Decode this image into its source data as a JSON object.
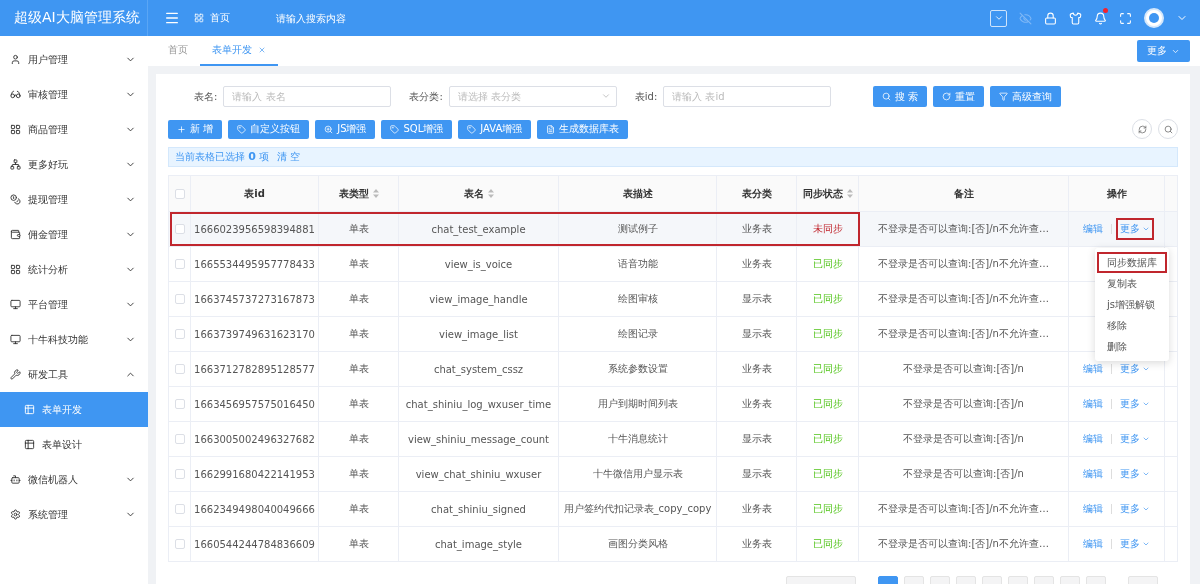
{
  "app": {
    "title": "超级AI大脑管理系统"
  },
  "topbar": {
    "home": "首页",
    "search": {
      "placeholder": "请输入搜索内容"
    },
    "notification_dot": true
  },
  "sidebar": {
    "items": [
      {
        "label": "用户管理",
        "expanded": false
      },
      {
        "label": "审核管理",
        "expanded": false
      },
      {
        "label": "商品管理",
        "expanded": false
      },
      {
        "label": "更多好玩",
        "expanded": false
      },
      {
        "label": "提现管理",
        "expanded": false
      },
      {
        "label": "佣金管理",
        "expanded": false
      },
      {
        "label": "统计分析",
        "expanded": false
      },
      {
        "label": "平台管理",
        "expanded": false
      },
      {
        "label": "十牛科技功能",
        "expanded": false
      },
      {
        "label": "研发工具",
        "expanded": true,
        "children": [
          {
            "label": "表单开发",
            "selected": true
          },
          {
            "label": "表单设计",
            "selected": false
          }
        ]
      },
      {
        "label": "微信机器人",
        "expanded": false
      },
      {
        "label": "系统管理",
        "expanded": false
      }
    ]
  },
  "tabs": [
    {
      "label": "首页",
      "selected": false,
      "closable": false
    },
    {
      "label": "表单开发",
      "selected": true,
      "closable": true
    }
  ],
  "tabs_more": "更多",
  "filters": [
    {
      "label": "表名:",
      "kind": "input",
      "placeholder": "请输入 表名"
    },
    {
      "label": "表分类:",
      "kind": "select",
      "placeholder": "请选择 表分类"
    },
    {
      "label": "表id:",
      "kind": "input",
      "placeholder": "请输入 表id"
    }
  ],
  "filter_buttons": [
    "搜 索",
    "重置",
    "高级查询"
  ],
  "toolbar": [
    "新 增",
    "自定义按钮",
    "JS增强",
    "SQL增强",
    "JAVA增强",
    "生成数据库表"
  ],
  "selection": {
    "text": "当前表格已选择 **0** 项",
    "clear": "清 空"
  },
  "table": {
    "all_checked": false,
    "columns": [
      {
        "label": "表id",
        "sortable": false
      },
      {
        "label": "表类型",
        "sortable": true
      },
      {
        "label": "表名",
        "sortable": true
      },
      {
        "label": "表描述",
        "sortable": false
      },
      {
        "label": "表分类",
        "sortable": false
      },
      {
        "label": "同步状态",
        "sortable": true
      },
      {
        "label": "备注",
        "sortable": false
      },
      {
        "label": "操作",
        "sortable": false
      }
    ],
    "rows": [
      {
        "checked": false,
        "id": "1666023956598394881",
        "type": "单表",
        "name": "chat_test_example",
        "desc": "测试例子",
        "category": "业务表",
        "sync": "未同步",
        "synced": false,
        "remark": "不登录是否可以查询:[否]/n不允许查…",
        "actions": [
          "编辑",
          "更多"
        ],
        "highlighted": true,
        "hovered": true
      },
      {
        "checked": false,
        "id": "1665534495957778433",
        "type": "单表",
        "name": "view_is_voice",
        "desc": "语音功能",
        "category": "业务表",
        "sync": "已同步",
        "synced": true,
        "remark": "不登录是否可以查询:[否]/n不允许查…",
        "highlighted": false,
        "hovered": false
      },
      {
        "checked": false,
        "id": "1663745737273167873",
        "type": "单表",
        "name": "view_image_handle",
        "desc": "绘图审核",
        "category": "显示表",
        "sync": "已同步",
        "synced": true,
        "remark": "不登录是否可以查询:[否]/n不允许查…",
        "highlighted": false,
        "hovered": false
      },
      {
        "checked": false,
        "id": "1663739749631623170",
        "type": "单表",
        "name": "view_image_list",
        "desc": "绘图记录",
        "category": "显示表",
        "sync": "已同步",
        "synced": true,
        "remark": "不登录是否可以查询:[否]/n不允许查…",
        "highlighted": false,
        "hovered": false
      },
      {
        "checked": false,
        "id": "1663712782895128577",
        "type": "单表",
        "name": "chat_system_cssz",
        "desc": "系统参数设置",
        "category": "业务表",
        "sync": "已同步",
        "synced": true,
        "remark": "不登录是否可以查询:[否]/n",
        "actions": [
          "编辑",
          "更多"
        ],
        "highlighted": false,
        "hovered": false
      },
      {
        "checked": false,
        "id": "1663456957575016450",
        "type": "单表",
        "name": "chat_shiniu_log_wxuser_time",
        "desc": "用户到期时间列表",
        "category": "业务表",
        "sync": "已同步",
        "synced": true,
        "remark": "不登录是否可以查询:[否]/n",
        "actions": [
          "编辑",
          "更多"
        ],
        "highlighted": false,
        "hovered": false
      },
      {
        "checked": false,
        "id": "1663005002496327682",
        "type": "单表",
        "name": "view_shiniu_message_count",
        "desc": "十牛消息统计",
        "category": "显示表",
        "sync": "已同步",
        "synced": true,
        "remark": "不登录是否可以查询:[否]/n",
        "actions": [
          "编辑",
          "更多"
        ],
        "highlighted": false,
        "hovered": false
      },
      {
        "checked": false,
        "id": "1662991680422141953",
        "type": "单表",
        "name": "view_chat_shiniu_wxuser",
        "desc": "十牛微信用户显示表",
        "category": "显示表",
        "sync": "已同步",
        "synced": true,
        "remark": "不登录是否可以查询:[否]/n",
        "actions": [
          "编辑",
          "更多"
        ],
        "highlighted": false,
        "hovered": false
      },
      {
        "checked": false,
        "id": "1662349498040049666",
        "type": "单表",
        "name": "chat_shiniu_signed",
        "desc": "用户签约代扣记录表_copy_copy",
        "category": "业务表",
        "sync": "已同步",
        "synced": true,
        "remark": "不登录是否可以查询:[否]/n不允许查…",
        "actions": [
          "编辑",
          "更多"
        ],
        "highlighted": false,
        "hovered": false
      },
      {
        "checked": false,
        "id": "1660544244784836609",
        "type": "单表",
        "name": "chat_image_style",
        "desc": "画图分类风格",
        "category": "业务表",
        "sync": "已同步",
        "synced": true,
        "remark": "不登录是否可以查询:[否]/n不允许查…",
        "actions": [
          "编辑",
          "更多"
        ],
        "highlighted": false,
        "hovered": false
      }
    ]
  },
  "dropdown": {
    "items": [
      {
        "label": "同步数据库",
        "highlighted": true
      },
      {
        "label": "复制表",
        "highlighted": false
      },
      {
        "label": "js增强解锁",
        "highlighted": false
      },
      {
        "label": "移除",
        "highlighted": false
      },
      {
        "label": "删除",
        "highlighted": false
      }
    ]
  },
  "pagination": {
    "pages": [
      {
        "selected": true
      },
      {
        "selected": false
      },
      {
        "selected": false
      },
      {
        "selected": false
      },
      {
        "selected": false
      },
      {
        "selected": false
      },
      {
        "selected": false
      },
      {
        "selected": false
      },
      {
        "selected": false
      }
    ]
  }
}
